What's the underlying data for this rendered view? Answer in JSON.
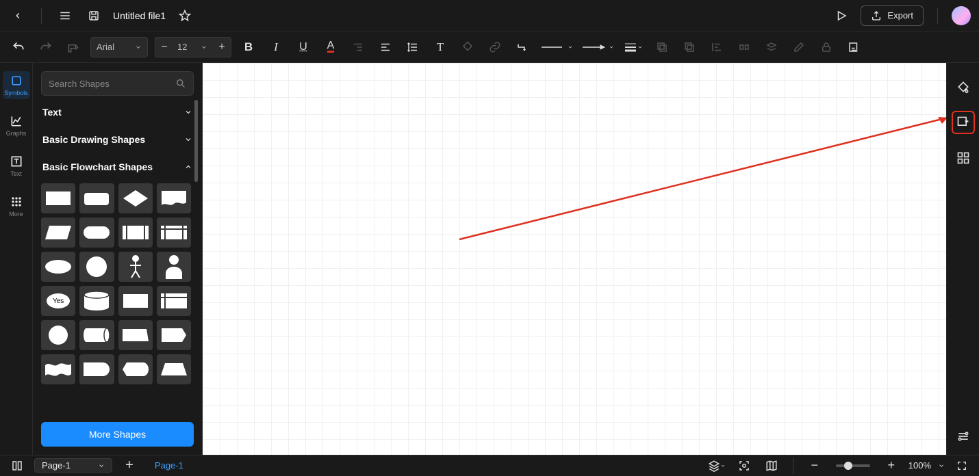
{
  "header": {
    "file_title": "Untitled file1",
    "export_label": "Export"
  },
  "toolbar": {
    "font_family": "Arial",
    "font_size": "12"
  },
  "sidenav": {
    "symbols": "Symbols",
    "graphs": "Graphs",
    "text": "Text",
    "more": "More"
  },
  "shapes": {
    "search_placeholder": "Search Shapes",
    "section_text": "Text",
    "section_basic_draw": "Basic Drawing Shapes",
    "section_flowchart": "Basic Flowchart Shapes",
    "more_button": "More Shapes",
    "flowchart_shapes": [
      "process",
      "terminator-rounded",
      "decision",
      "document",
      "parallelogram",
      "pill",
      "predefined",
      "internal-storage",
      "ellipse",
      "circle",
      "person-stick",
      "person-solid",
      "yes-no",
      "cylinder",
      "card",
      "stored-data",
      "connector",
      "direct-data",
      "manual-op",
      "offpage",
      "tape",
      "delay",
      "display",
      "trapezoid"
    ],
    "yes_label": "Yes"
  },
  "pages": {
    "selector": "Page-1",
    "tab": "Page-1"
  },
  "zoom": {
    "level": "100%"
  }
}
